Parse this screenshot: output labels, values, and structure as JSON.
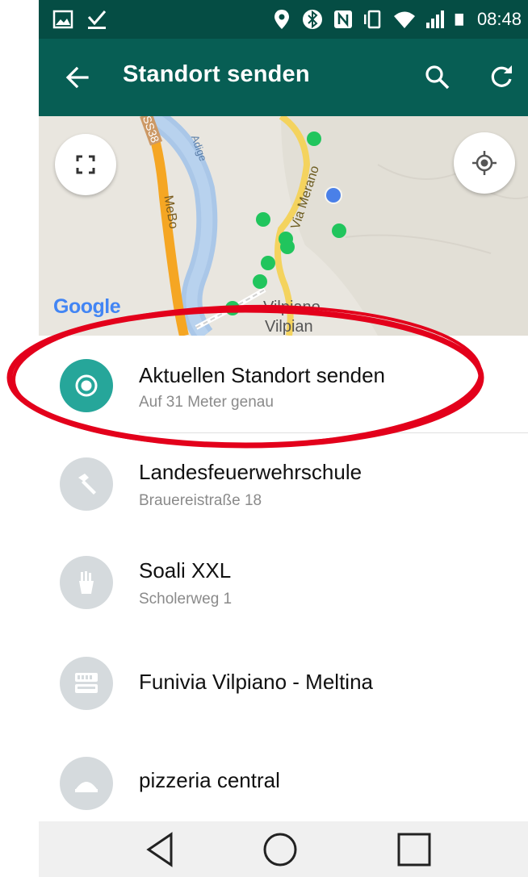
{
  "status_bar": {
    "time": "08:48",
    "left_icons": [
      "image-icon",
      "download-check-icon"
    ],
    "right_icons": [
      "location-pin-icon",
      "bluetooth-icon",
      "nfc-icon",
      "vibrate-icon",
      "wifi-icon",
      "signal-icon",
      "battery-icon"
    ]
  },
  "app_bar": {
    "title": "Standort senden",
    "back_icon": "arrow-back-icon",
    "actions": [
      "search-icon",
      "refresh-icon"
    ]
  },
  "map": {
    "attribution": "Google",
    "labels": {
      "road_mebo": "MeBo",
      "road_merano": "Via Merano",
      "river": "Adige",
      "shield": "SS38",
      "town_it": "Vilpiano",
      "town_de": "Vilpian"
    },
    "buttons": [
      "fullscreen-icon",
      "my-location-icon"
    ]
  },
  "places": [
    {
      "name": "Aktuellen Standort senden",
      "subtitle": "Auf 31 Meter genau",
      "icon": "current-location-icon",
      "color": "#26a69a"
    },
    {
      "name": "Landesfeuerwehrschule",
      "subtitle": "Brauereistraße 18",
      "icon": "hammer-icon",
      "color": "#d5dadd"
    },
    {
      "name": "Soali XXL",
      "subtitle": "Scholerweg 1",
      "icon": "fries-icon",
      "color": "#d5dadd"
    },
    {
      "name": "Funivia Vilpiano - Meltina",
      "subtitle": "",
      "icon": "cable-car-icon",
      "color": "#d5dadd"
    },
    {
      "name": "pizzeria central",
      "subtitle": "",
      "icon": "food-icon",
      "color": "#d5dadd"
    }
  ],
  "nav_bar": [
    "back-triangle-icon",
    "home-circle-icon",
    "recents-square-icon"
  ],
  "colors": {
    "status_bar": "#054d44",
    "app_bar": "#075e54",
    "accent": "#26a69a",
    "annotation": "#e3001b"
  }
}
